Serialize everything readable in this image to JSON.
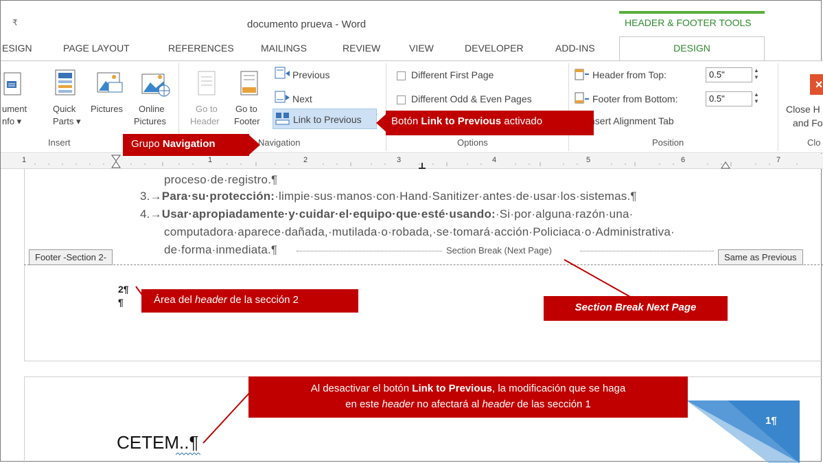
{
  "window": {
    "qat_symbol": "₹",
    "title": "documento prueva - Word",
    "contextual_tab_group": "HEADER & FOOTER TOOLS"
  },
  "tabs": [
    "ESIGN",
    "PAGE LAYOUT",
    "REFERENCES",
    "MAILINGS",
    "REVIEW",
    "VIEW",
    "DEVELOPER",
    "ADD-INS",
    "DESIGN"
  ],
  "ribbon": {
    "insert": {
      "document_info": [
        "ument",
        "nfo ▾"
      ],
      "quick_parts": [
        "Quick",
        "Parts ▾"
      ],
      "pictures": "Pictures",
      "online_pictures": [
        "Online",
        "Pictures"
      ],
      "group_label": "Insert"
    },
    "navigation": {
      "goto_header": [
        "Go to",
        "Header"
      ],
      "goto_footer": [
        "Go to",
        "Footer"
      ],
      "previous": "Previous",
      "next": "Next",
      "link_to_previous": "Link to Previous",
      "group_label": "Navigation"
    },
    "options": {
      "different_first_page": "Different First Page",
      "different_odd_even": "Different Odd & Even Pages",
      "group_label": "Options"
    },
    "position": {
      "header_from_top_label": "Header from Top:",
      "header_from_top_value": "0.5\"",
      "footer_from_bottom_label": "Footer from Bottom:",
      "footer_from_bottom_value": "0.5\"",
      "insert_alignment_tab": "nsert Alignment Tab",
      "group_label": "Position"
    },
    "close": {
      "label": [
        "Close H",
        "and Fo"
      ],
      "group_label": "Clo"
    }
  },
  "ruler": {
    "numbers": [
      "1",
      "1",
      "2",
      "3",
      "4",
      "5",
      "6",
      "7"
    ]
  },
  "document": {
    "line1": "proceso·de·registro.¶",
    "item3_num": "3.→",
    "item3_bold": "Para·su·protección:",
    "item3_text": "·limpie·sus·manos·con·Hand·Sanitizer·antes·de·usar·los·sistemas.¶",
    "item4_num": "4.→",
    "item4_bold": "Usar·apropiadamente·y·cuidar·el·equipo·que·esté·usando:",
    "item4_text": "·Si·por·alguna·razón·una·",
    "item4_line2": "computadora·aparece·dañada,·mutilada·o·robada,·se·tomará·acción·Policiaca·o·Administrativa·",
    "item4_line3": "de·forma·inmediata.¶",
    "section_break": "Section Break (Next Page)",
    "footer_tag": "Footer -Section 2-",
    "same_as_previous": "Same as Previous",
    "footer_line1": "2¶",
    "footer_line2": "¶",
    "page2_heading": "CETEM..¶",
    "page2_number": "1¶"
  },
  "callouts": {
    "link_prev_pre": "Botón ",
    "link_prev_bold": "Link to Previous",
    "link_prev_post": " activado",
    "grupo_pre": "Grupo ",
    "grupo_bold": "Navigation",
    "area_pre": "Área del ",
    "area_italic": "header",
    "area_post": " de la sección 2",
    "section_break_note": "Section Break Next Page",
    "note_l1_pre": "Al desactivar el botón ",
    "note_l1_bold": "Link to Previous",
    "note_l1_post": ", la modificación que se haga",
    "note_l2_a": "en este ",
    "note_l2_italic1": "header",
    "note_l2_b": "  no afectará al ",
    "note_l2_italic2": "header",
    "note_l2_c": " de las sección 1"
  },
  "colors": {
    "accent_green": "#2e8b2e",
    "callout_red": "#c00000",
    "highlight_blue": "#cde0f4",
    "wedge_blue": "#3a86cc"
  }
}
